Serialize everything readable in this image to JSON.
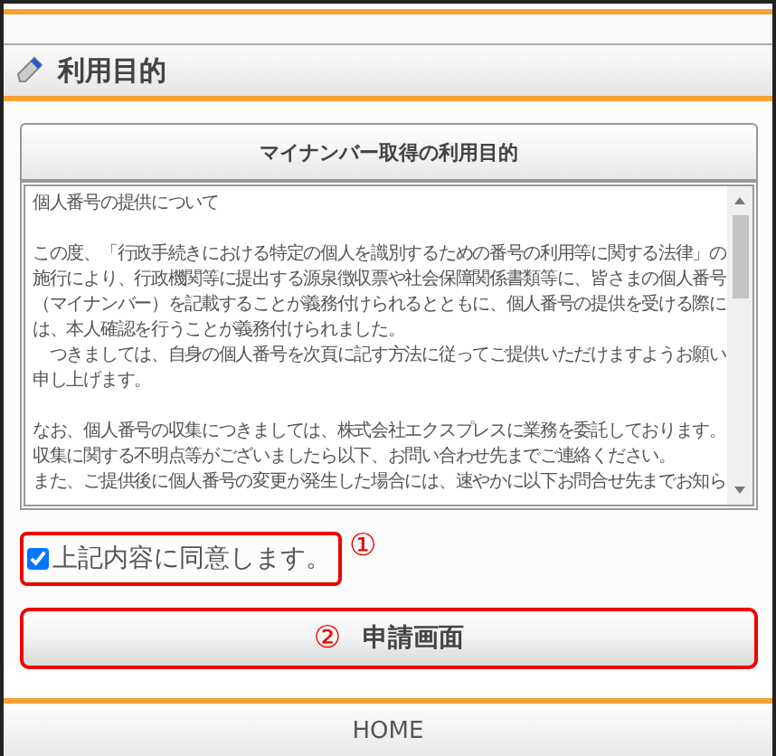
{
  "header": {
    "title": "利用目的"
  },
  "purpose_panel": {
    "title": "マイナンバー取得の利用目的",
    "paragraphs": [
      [
        "個人番号の提供について"
      ],
      [
        "この度、「行政手続きにおける特定の個人を識別するための番号の利用等に関する法律」の",
        "施行により、行政機関等に提出する源泉徴収票や社会保障関係書類等に、皆さまの個人番号",
        "（マイナンバー）を記載することが義務付けられるとともに、個人番号の提供を受ける際に",
        "は、本人確認を行うことが義務付けられました。",
        "　つきましては、自身の個人番号を次頁に記す方法に従ってご提供いただけますようお願い",
        "申し上げます。"
      ],
      [
        "なお、個人番号の収集につきましては、株式会社エクスプレスに業務を委託しております。",
        "収集に関する不明点等がございましたら以下、お問い合わせ先までご連絡ください。",
        "また、ご提供後に個人番号の変更が発生した場合には、速やかに以下お問合せ先までお知ら"
      ]
    ]
  },
  "agree_checkbox": {
    "label": "上記内容に同意します。",
    "checked": true,
    "marker": "①"
  },
  "apply_button": {
    "label": "申請画面",
    "marker": "②"
  },
  "footer": {
    "label": "HOME"
  }
}
